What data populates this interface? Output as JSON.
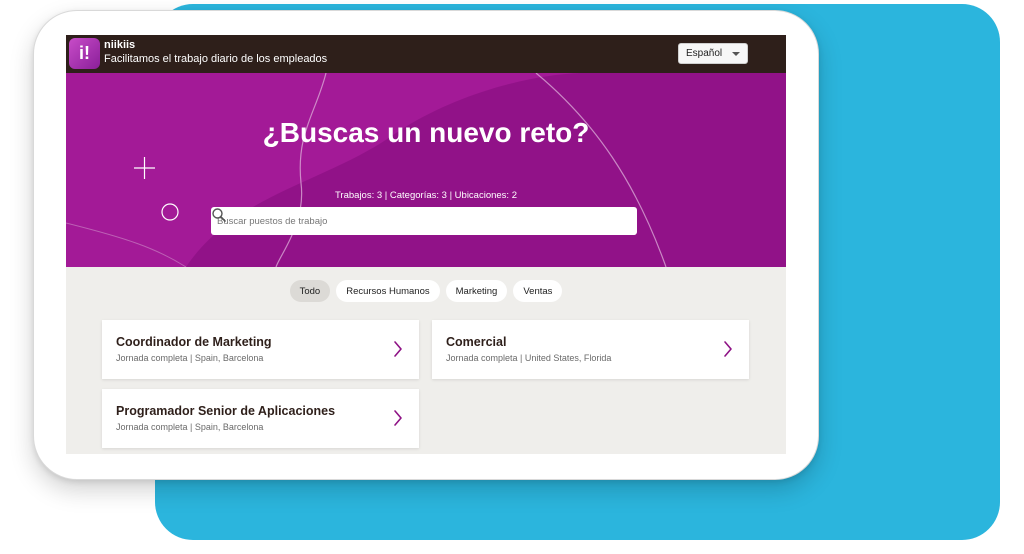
{
  "app": {
    "name": "niikiis",
    "tagline": "Facilitamos el trabajo diario de los empleados",
    "logo_glyph": "i!",
    "language": "Español"
  },
  "hero": {
    "title": "¿Buscas un nuevo reto?",
    "stats": "Trabajos: 3 |  Categorías: 3 |  Ubicaciones: 2",
    "search_placeholder": "Buscar puestos de trabajo"
  },
  "filters": [
    {
      "label": "Todo",
      "active": true
    },
    {
      "label": "Recursos Humanos",
      "active": false
    },
    {
      "label": "Marketing",
      "active": false
    },
    {
      "label": "Ventas",
      "active": false
    }
  ],
  "jobs": [
    {
      "title": "Coordinador de Marketing",
      "meta": "Jornada completa  |  Spain, Barcelona"
    },
    {
      "title": "Comercial",
      "meta": "Jornada completa  |  United States, Florida"
    },
    {
      "title": "Programador Senior de Aplicaciones",
      "meta": "Jornada completa  |  Spain, Barcelona"
    }
  ],
  "colors": {
    "accent": "#a31a97",
    "topbar": "#2e1f1a",
    "teal_backdrop": "#2bb5dd",
    "page_bg": "#efeeeb"
  },
  "icons": {
    "search": "search-icon",
    "chevron": "chevron-right-icon",
    "dropdown": "chevron-down-icon"
  }
}
